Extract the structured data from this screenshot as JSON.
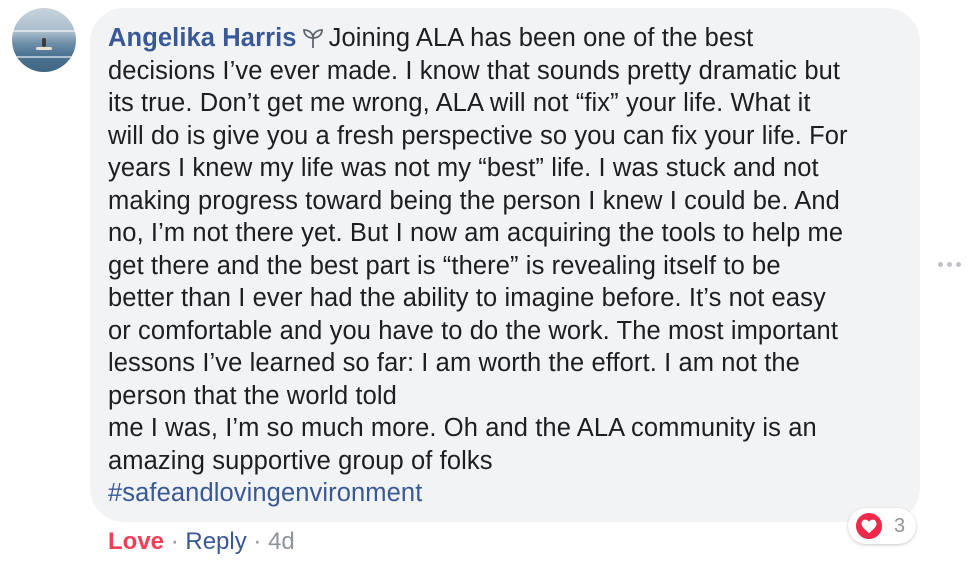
{
  "comment": {
    "author": "Angelika Harris",
    "author_badge_icon": "sprout-icon",
    "first_line": "Joining ALA has been one of the best",
    "lines": [
      "decisions I’ve ever made. I know that sounds pretty dramatic but",
      "its true. Don’t get me wrong, ALA will not “fix” your life. What it",
      "will do is give you a fresh perspective so you can fix your life. For",
      "years I knew my life was not my “best” life. I was stuck and not",
      "making progress toward being the person I knew I could be. And",
      "no, I’m not there yet. But I now am acquiring the tools to help me",
      "get there and the best part is “there” is revealing itself to be",
      "better than I ever had the ability to imagine before. It’s not easy",
      "or comfortable and you have to do the work. The most important",
      "lessons I’ve learned so far: I am worth the effort. I am not the",
      "person that the world told",
      "me I was, I’m so much more. Oh and the ALA community is an",
      "amazing supportive group of folks"
    ],
    "hashtag": "#safeandlovingenvironment"
  },
  "reactions": {
    "icon": "heart-icon",
    "count": "3",
    "color": "#f0284a"
  },
  "actions": {
    "love_label": "Love",
    "separator": "·",
    "reply_label": "Reply",
    "timestamp": "4d"
  },
  "colors": {
    "author": "#385898",
    "bubble": "#f2f3f5",
    "love": "#f33e58",
    "muted": "#90949c"
  }
}
